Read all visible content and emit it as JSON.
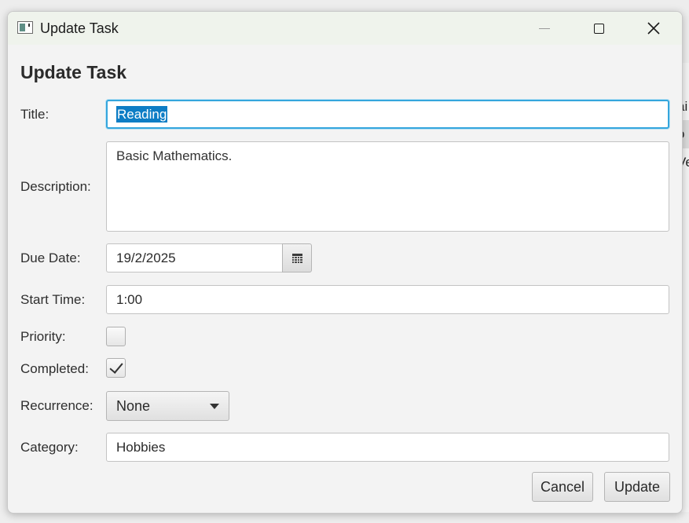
{
  "window": {
    "title": "Update Task"
  },
  "background": {
    "rows": [
      "ai",
      "o",
      "Ve"
    ]
  },
  "form": {
    "heading": "Update Task",
    "title": {
      "label": "Title:",
      "value": "Reading"
    },
    "description": {
      "label": "Description:",
      "value": "Basic Mathematics."
    },
    "due_date": {
      "label": "Due Date:",
      "value": "19/2/2025"
    },
    "start_time": {
      "label": "Start Time:",
      "value": "1:00"
    },
    "priority": {
      "label": "Priority:",
      "checked": false
    },
    "completed": {
      "label": "Completed:",
      "checked": true
    },
    "recurrence": {
      "label": "Recurrence:",
      "selected": "None"
    },
    "category": {
      "label": "Category:",
      "value": "Hobbies"
    }
  },
  "buttons": {
    "cancel": "Cancel",
    "update": "Update"
  },
  "colors": {
    "focus_border": "#35a6dd",
    "selection": "#0e7dc5"
  },
  "icons": {
    "app": "app-window-icon",
    "minimize": "minimize-icon",
    "maximize": "maximize-icon",
    "close": "close-icon",
    "calendar": "calendar-icon",
    "dropdown": "chevron-down-icon",
    "check": "checkmark-icon"
  }
}
